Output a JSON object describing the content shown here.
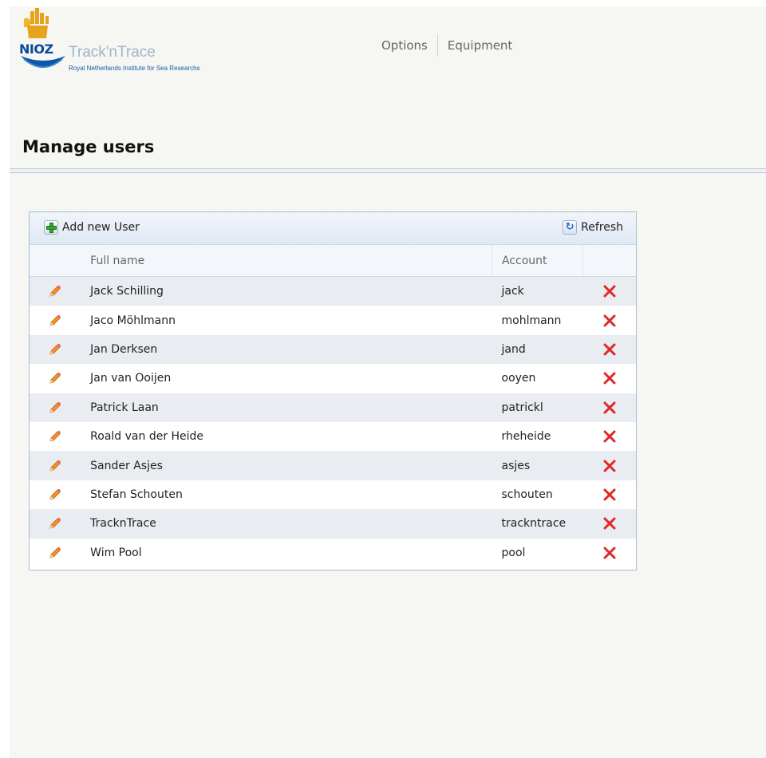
{
  "header": {
    "logo_mark": "NIOZ",
    "logo_title": "Track'nTrace",
    "logo_subtitle": "Royal Netherlands Institute for Sea Researchs",
    "nav": [
      {
        "label": "Options"
      },
      {
        "label": "Equipment"
      }
    ]
  },
  "page": {
    "title": "Manage users"
  },
  "toolbar": {
    "add_label": "Add new User",
    "refresh_label": "Refresh"
  },
  "table": {
    "columns": {
      "full_name": "Full name",
      "account": "Account"
    },
    "rows": [
      {
        "full_name": "Jack Schilling",
        "account": "jack"
      },
      {
        "full_name": "Jaco Möhlmann",
        "account": "mohlmann"
      },
      {
        "full_name": "Jan Derksen",
        "account": "jand"
      },
      {
        "full_name": "Jan van Ooijen",
        "account": "ooyen"
      },
      {
        "full_name": "Patrick Laan",
        "account": "patrickl"
      },
      {
        "full_name": "Roald van der Heide",
        "account": "rheheide"
      },
      {
        "full_name": "Sander Asjes",
        "account": "asjes"
      },
      {
        "full_name": "Stefan Schouten",
        "account": "schouten"
      },
      {
        "full_name": "TracknTrace",
        "account": "trackntrace"
      },
      {
        "full_name": "Wim Pool",
        "account": "pool"
      }
    ]
  },
  "icons": {
    "add": "add-icon",
    "refresh": "refresh-icon",
    "edit": "pencil-icon",
    "delete": "delete-icon"
  },
  "colors": {
    "accent": "#0b4a9a",
    "logo_gold": "#e8a21b",
    "delete_red": "#e0282a",
    "row_alt": "#e9ecf1"
  }
}
